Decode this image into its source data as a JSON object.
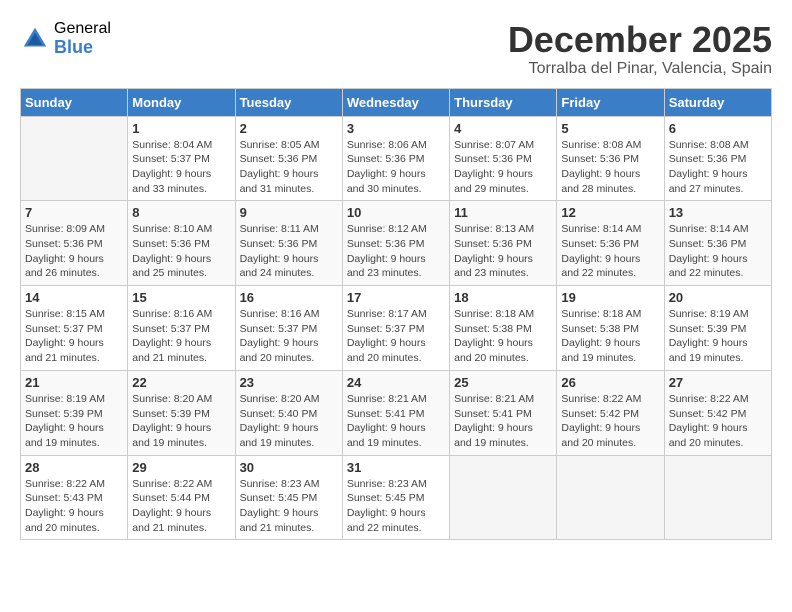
{
  "logo": {
    "general": "General",
    "blue": "Blue"
  },
  "title": {
    "month": "December 2025",
    "location": "Torralba del Pinar, Valencia, Spain"
  },
  "weekdays": [
    "Sunday",
    "Monday",
    "Tuesday",
    "Wednesday",
    "Thursday",
    "Friday",
    "Saturday"
  ],
  "weeks": [
    [
      {
        "day": "",
        "info": ""
      },
      {
        "day": "1",
        "info": "Sunrise: 8:04 AM\nSunset: 5:37 PM\nDaylight: 9 hours\nand 33 minutes."
      },
      {
        "day": "2",
        "info": "Sunrise: 8:05 AM\nSunset: 5:36 PM\nDaylight: 9 hours\nand 31 minutes."
      },
      {
        "day": "3",
        "info": "Sunrise: 8:06 AM\nSunset: 5:36 PM\nDaylight: 9 hours\nand 30 minutes."
      },
      {
        "day": "4",
        "info": "Sunrise: 8:07 AM\nSunset: 5:36 PM\nDaylight: 9 hours\nand 29 minutes."
      },
      {
        "day": "5",
        "info": "Sunrise: 8:08 AM\nSunset: 5:36 PM\nDaylight: 9 hours\nand 28 minutes."
      },
      {
        "day": "6",
        "info": "Sunrise: 8:08 AM\nSunset: 5:36 PM\nDaylight: 9 hours\nand 27 minutes."
      }
    ],
    [
      {
        "day": "7",
        "info": "Sunrise: 8:09 AM\nSunset: 5:36 PM\nDaylight: 9 hours\nand 26 minutes."
      },
      {
        "day": "8",
        "info": "Sunrise: 8:10 AM\nSunset: 5:36 PM\nDaylight: 9 hours\nand 25 minutes."
      },
      {
        "day": "9",
        "info": "Sunrise: 8:11 AM\nSunset: 5:36 PM\nDaylight: 9 hours\nand 24 minutes."
      },
      {
        "day": "10",
        "info": "Sunrise: 8:12 AM\nSunset: 5:36 PM\nDaylight: 9 hours\nand 23 minutes."
      },
      {
        "day": "11",
        "info": "Sunrise: 8:13 AM\nSunset: 5:36 PM\nDaylight: 9 hours\nand 23 minutes."
      },
      {
        "day": "12",
        "info": "Sunrise: 8:14 AM\nSunset: 5:36 PM\nDaylight: 9 hours\nand 22 minutes."
      },
      {
        "day": "13",
        "info": "Sunrise: 8:14 AM\nSunset: 5:36 PM\nDaylight: 9 hours\nand 22 minutes."
      }
    ],
    [
      {
        "day": "14",
        "info": "Sunrise: 8:15 AM\nSunset: 5:37 PM\nDaylight: 9 hours\nand 21 minutes."
      },
      {
        "day": "15",
        "info": "Sunrise: 8:16 AM\nSunset: 5:37 PM\nDaylight: 9 hours\nand 21 minutes."
      },
      {
        "day": "16",
        "info": "Sunrise: 8:16 AM\nSunset: 5:37 PM\nDaylight: 9 hours\nand 20 minutes."
      },
      {
        "day": "17",
        "info": "Sunrise: 8:17 AM\nSunset: 5:37 PM\nDaylight: 9 hours\nand 20 minutes."
      },
      {
        "day": "18",
        "info": "Sunrise: 8:18 AM\nSunset: 5:38 PM\nDaylight: 9 hours\nand 20 minutes."
      },
      {
        "day": "19",
        "info": "Sunrise: 8:18 AM\nSunset: 5:38 PM\nDaylight: 9 hours\nand 19 minutes."
      },
      {
        "day": "20",
        "info": "Sunrise: 8:19 AM\nSunset: 5:39 PM\nDaylight: 9 hours\nand 19 minutes."
      }
    ],
    [
      {
        "day": "21",
        "info": "Sunrise: 8:19 AM\nSunset: 5:39 PM\nDaylight: 9 hours\nand 19 minutes."
      },
      {
        "day": "22",
        "info": "Sunrise: 8:20 AM\nSunset: 5:39 PM\nDaylight: 9 hours\nand 19 minutes."
      },
      {
        "day": "23",
        "info": "Sunrise: 8:20 AM\nSunset: 5:40 PM\nDaylight: 9 hours\nand 19 minutes."
      },
      {
        "day": "24",
        "info": "Sunrise: 8:21 AM\nSunset: 5:41 PM\nDaylight: 9 hours\nand 19 minutes."
      },
      {
        "day": "25",
        "info": "Sunrise: 8:21 AM\nSunset: 5:41 PM\nDaylight: 9 hours\nand 19 minutes."
      },
      {
        "day": "26",
        "info": "Sunrise: 8:22 AM\nSunset: 5:42 PM\nDaylight: 9 hours\nand 20 minutes."
      },
      {
        "day": "27",
        "info": "Sunrise: 8:22 AM\nSunset: 5:42 PM\nDaylight: 9 hours\nand 20 minutes."
      }
    ],
    [
      {
        "day": "28",
        "info": "Sunrise: 8:22 AM\nSunset: 5:43 PM\nDaylight: 9 hours\nand 20 minutes."
      },
      {
        "day": "29",
        "info": "Sunrise: 8:22 AM\nSunset: 5:44 PM\nDaylight: 9 hours\nand 21 minutes."
      },
      {
        "day": "30",
        "info": "Sunrise: 8:23 AM\nSunset: 5:45 PM\nDaylight: 9 hours\nand 21 minutes."
      },
      {
        "day": "31",
        "info": "Sunrise: 8:23 AM\nSunset: 5:45 PM\nDaylight: 9 hours\nand 22 minutes."
      },
      {
        "day": "",
        "info": ""
      },
      {
        "day": "",
        "info": ""
      },
      {
        "day": "",
        "info": ""
      }
    ]
  ]
}
